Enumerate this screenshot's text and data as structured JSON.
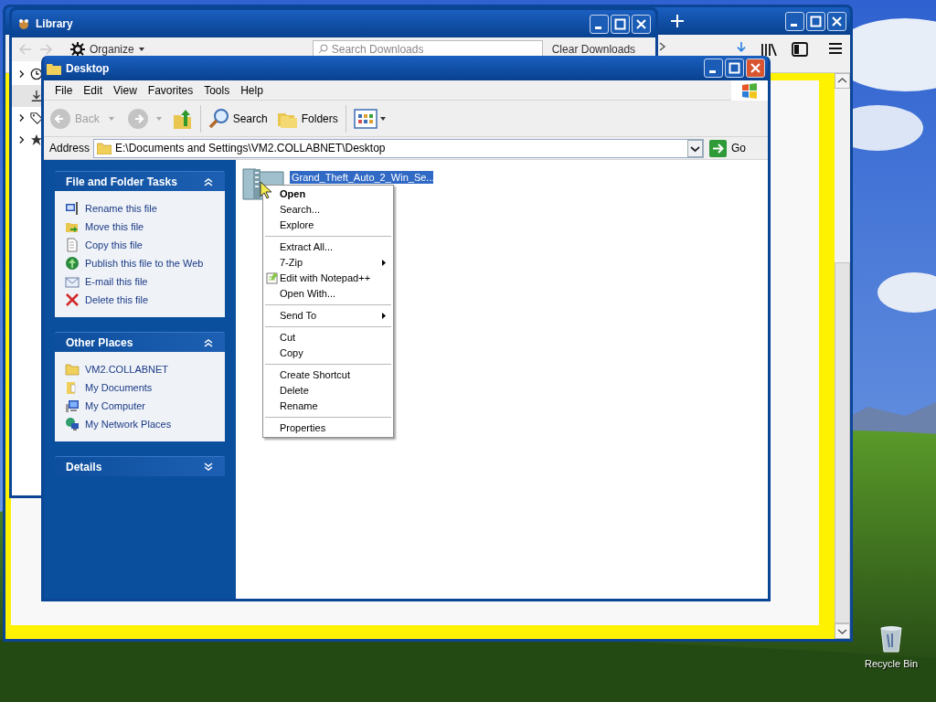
{
  "desktop": {
    "icons": [
      {
        "label": "Recycle Bin"
      }
    ]
  },
  "library_window": {
    "title": "Library",
    "organize": "Organize",
    "search_placeholder": "Search Downloads",
    "clear_button": "Clear Downloads",
    "sidebar_items": [
      {
        "kind": "history",
        "selected": false
      },
      {
        "kind": "downloads",
        "selected": true
      },
      {
        "kind": "tags",
        "selected": false
      },
      {
        "kind": "bookmarks",
        "selected": false
      }
    ]
  },
  "explorer_window": {
    "title": "Desktop",
    "menu": [
      "File",
      "Edit",
      "View",
      "Favorites",
      "Tools",
      "Help"
    ],
    "toolbar": {
      "back": {
        "label": "Back",
        "disabled": true
      },
      "forward_disabled": true,
      "search": "Search",
      "folders": "Folders"
    },
    "address": {
      "label": "Address",
      "value": "E:\\Documents and Settings\\VM2.COLLABNET\\Desktop",
      "go": "Go"
    },
    "task_panes": [
      {
        "title": "File and Folder Tasks",
        "expanded": true,
        "items": [
          "Rename this file",
          "Move this file",
          "Copy this file",
          "Publish this file to the Web",
          "E-mail this file",
          "Delete this file"
        ]
      },
      {
        "title": "Other Places",
        "expanded": true,
        "items": [
          "VM2.COLLABNET",
          "My Documents",
          "My Computer",
          "My Network Places"
        ]
      },
      {
        "title": "Details",
        "expanded": false
      }
    ],
    "files": [
      {
        "name": "Grand_Theft_Auto_2_Win_Se...",
        "selected": true
      }
    ]
  },
  "context_menu": {
    "groups": [
      [
        {
          "label": "Open",
          "default": true,
          "submenu": false,
          "kind": "text"
        },
        {
          "label": "Search...",
          "default": false,
          "submenu": false,
          "kind": "text"
        },
        {
          "label": "Explore",
          "default": false,
          "submenu": false,
          "kind": "text"
        }
      ],
      [
        {
          "label": "Extract All...",
          "default": false,
          "submenu": false,
          "kind": "text"
        },
        {
          "label": "7-Zip",
          "default": false,
          "submenu": true,
          "kind": "text"
        },
        {
          "label": "Edit with Notepad++",
          "default": false,
          "submenu": false,
          "kind": "icon"
        },
        {
          "label": "Open With...",
          "default": false,
          "submenu": false,
          "kind": "text"
        }
      ],
      [
        {
          "label": "Send To",
          "default": false,
          "submenu": true,
          "kind": "text"
        }
      ],
      [
        {
          "label": "Cut",
          "default": false,
          "submenu": false,
          "kind": "text"
        },
        {
          "label": "Copy",
          "default": false,
          "submenu": false,
          "kind": "text"
        }
      ],
      [
        {
          "label": "Create Shortcut",
          "default": false,
          "submenu": false,
          "kind": "text"
        },
        {
          "label": "Delete",
          "default": false,
          "submenu": false,
          "kind": "text"
        },
        {
          "label": "Rename",
          "default": false,
          "submenu": false,
          "kind": "text"
        }
      ],
      [
        {
          "label": "Properties",
          "default": false,
          "submenu": false,
          "kind": "text"
        }
      ]
    ]
  }
}
